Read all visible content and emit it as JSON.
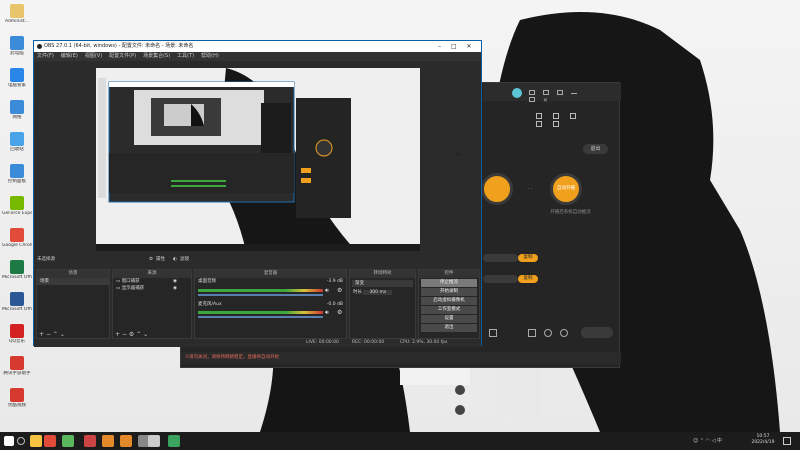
{
  "desktop": {
    "icons": [
      {
        "name": "administrator-icon",
        "label": "Administ...",
        "color": "#e8c46a"
      },
      {
        "name": "computer-icon",
        "label": "此电脑",
        "color": "#3b8bd8"
      },
      {
        "name": "app-qq-icon",
        "label": "电脑管家",
        "color": "#2a86e8"
      },
      {
        "name": "network-icon",
        "label": "网络",
        "color": "#3b8bd8"
      },
      {
        "name": "recycle-icon",
        "label": "回收站",
        "color": "#49a3e8"
      },
      {
        "name": "control-panel-icon",
        "label": "控制面板",
        "color": "#3b8bd8"
      },
      {
        "name": "nvidia-icon",
        "label": "GeForce Experience",
        "color": "#76b900"
      },
      {
        "name": "chrome-icon",
        "label": "Google Chrome",
        "color": "#e04b3a"
      },
      {
        "name": "excel-icon",
        "label": "Microsoft Office Exc...",
        "color": "#1e7a45"
      },
      {
        "name": "word-icon",
        "label": "Microsoft Office Wo...",
        "color": "#2b5797"
      },
      {
        "name": "qq-music-icon",
        "label": "QQ音乐",
        "color": "#d42222"
      },
      {
        "name": "game-icon",
        "label": "腾讯手游助手",
        "color": "#d63a2f"
      },
      {
        "name": "app-icon",
        "label": "优酷视频",
        "color": "#d63a2f"
      }
    ]
  },
  "taskbar": {
    "time": "10:57",
    "date": "2022/4/19",
    "apps": [
      {
        "name": "start-icon",
        "color": "#ffffff"
      },
      {
        "name": "explorer-icon",
        "color": "#f6c343"
      },
      {
        "name": "chrome-taskbar-icon",
        "color": "#e04b3a"
      },
      {
        "name": "app-green-icon",
        "color": "#5cb85c"
      },
      {
        "name": "avatar-taskbar-icon",
        "color": "#c44"
      },
      {
        "name": "orange-app-icon",
        "color": "#e58a2b"
      },
      {
        "name": "orange-app2-icon",
        "color": "#e58a2b"
      },
      {
        "name": "photo-app-icon",
        "color": "#888"
      },
      {
        "name": "obs-taskbar-icon",
        "color": "#cccccc"
      },
      {
        "name": "green-app-icon",
        "color": "#3aa35f"
      }
    ]
  },
  "obs": {
    "title": "OBS 27.0.1 (64-bit, windows) - 配置文件: 未命名 - 场景: 未命名",
    "menu": [
      "文件(F)",
      "编辑(E)",
      "视图(V)",
      "配置文件(P)",
      "场景集合(S)",
      "工具(T)",
      "帮助(H)"
    ],
    "scene_label": "未选择源",
    "props_btn": "属性",
    "filter_btn": "滤镜",
    "docks": {
      "scenes": {
        "title": "场景",
        "items": [
          "场景"
        ]
      },
      "sources": {
        "title": "来源",
        "items": [
          "窗口捕获",
          "显示器捕获"
        ]
      },
      "mixer": {
        "title": "混音器",
        "tracks": [
          {
            "name": "桌面音频",
            "db": "-3.9 dB"
          },
          {
            "name": "麦克风/Aux",
            "db": "-0.0 dB"
          }
        ]
      },
      "transitions": {
        "title": "转场特效",
        "type": "渐变",
        "duration_label": "时长",
        "duration": "300 ms"
      },
      "controls": {
        "title": "控件",
        "buttons": [
          "停止推流",
          "开始录制",
          "启动虚拟摄像机",
          "工作室模式",
          "设置",
          "退出"
        ]
      }
    },
    "status": {
      "live": "LIVE: 00:00:00",
      "rec": "REC: 00:00:00",
      "cpu": "CPU: 2.9%, 30.00 fps"
    }
  },
  "back_app": {
    "btn_exit": "退出",
    "auto_label": "自动开播",
    "desc": "开播后系统自动推流",
    "warn": "①请勿关闭，请保持网络稳定，直播将自动开始",
    "orange_btn": "复制"
  }
}
